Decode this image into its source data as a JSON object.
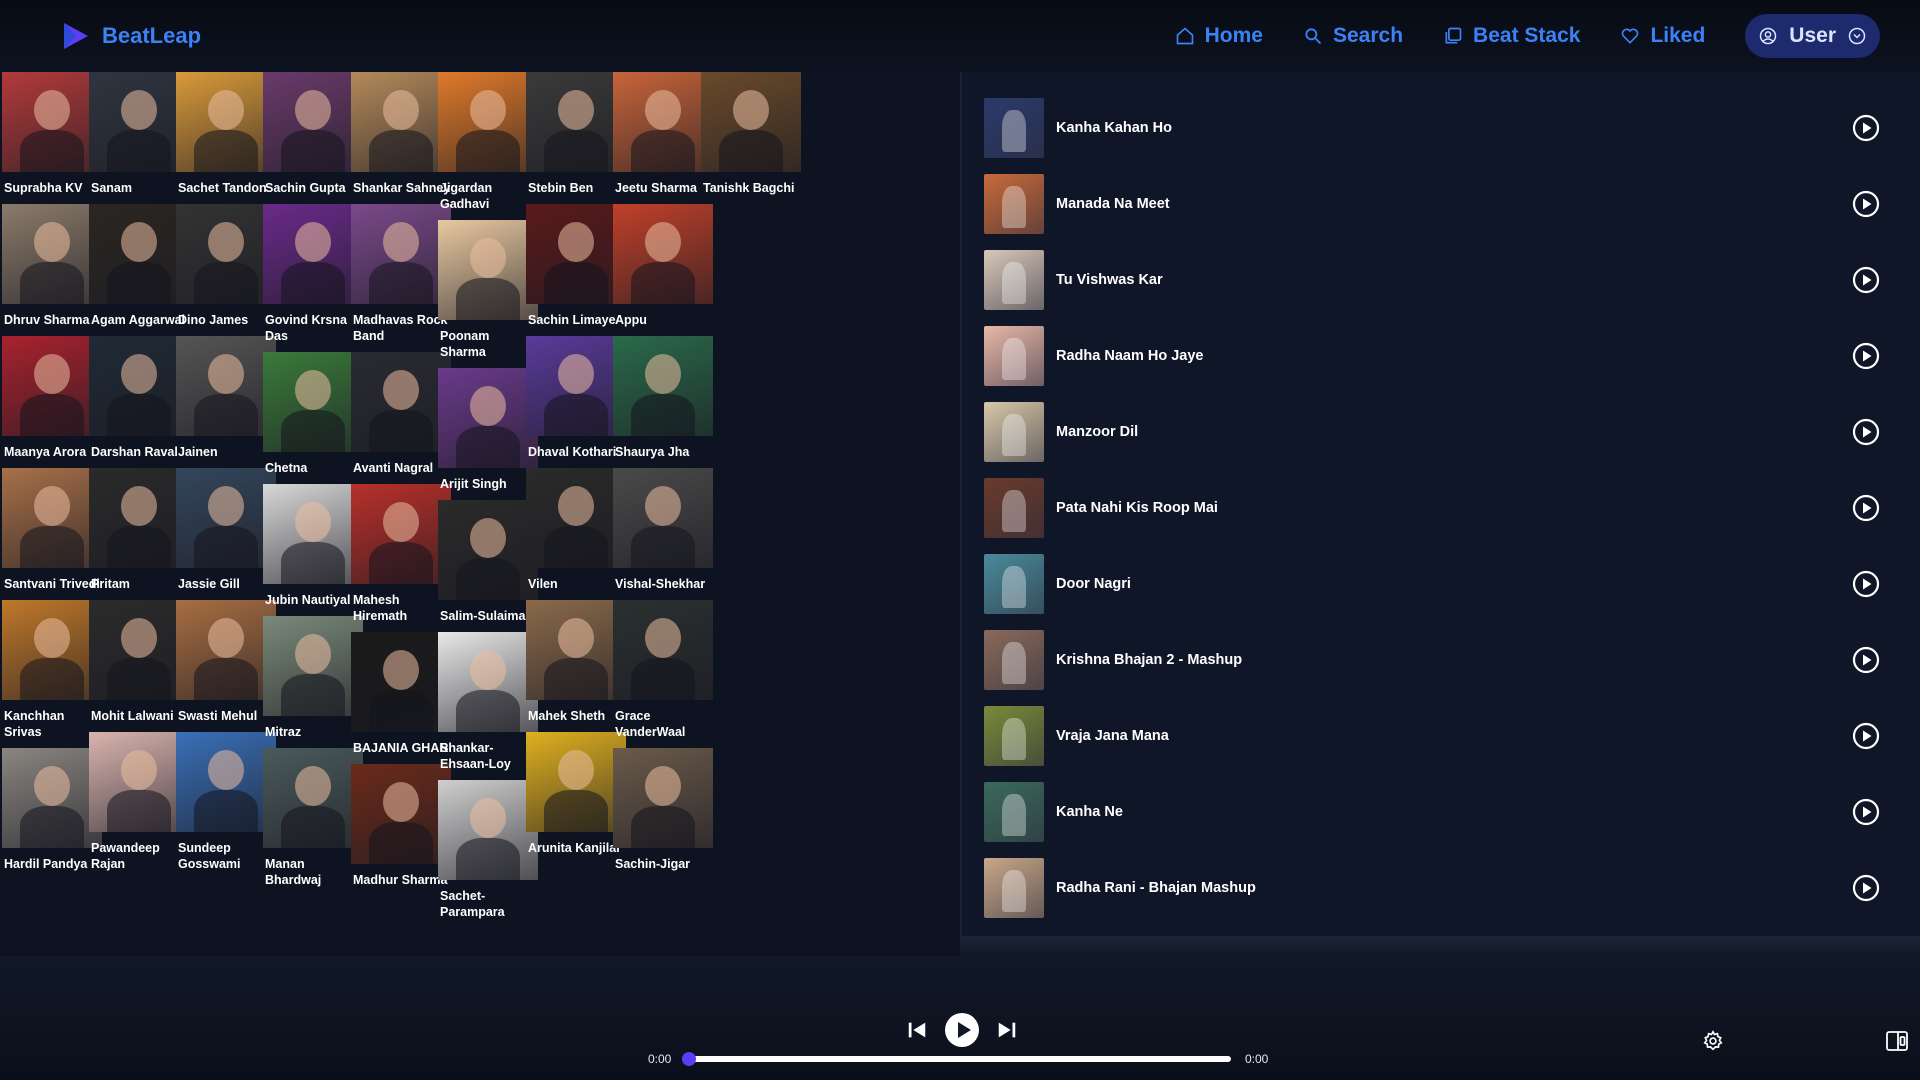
{
  "brand": {
    "name": "BeatLeap",
    "logo_icon": "play-triangle-logo"
  },
  "nav": {
    "home": "Home",
    "search": "Search",
    "beat_stack": "Beat Stack",
    "liked": "Liked",
    "user": "User"
  },
  "artists": {
    "columns": [
      [
        {
          "name": "Suprabha KV",
          "color": "#b23a3a"
        },
        {
          "name": "Dhruv Sharma",
          "color": "#8b7a6a"
        },
        {
          "name": "Maanya Arora",
          "color": "#a8222e"
        },
        {
          "name": "Santvani Trivedi",
          "color": "#a87048"
        },
        {
          "name": "Kanchhan Srivas",
          "color": "#c0782a"
        },
        {
          "name": "Hardil Pandya",
          "color": "#8a8580"
        }
      ],
      [
        {
          "name": "Sanam",
          "color": "#2f3540"
        },
        {
          "name": "Agam Aggarwal",
          "color": "#2a2622"
        },
        {
          "name": "Darshan Raval",
          "color": "#1f2a36"
        },
        {
          "name": "Pritam",
          "color": "#2a2a2a"
        },
        {
          "name": "Mohit Lalwani",
          "color": "#2b2b2b"
        },
        {
          "name": "Pawandeep Rajan",
          "color": "#d9b4ae"
        }
      ],
      [
        {
          "name": "Sachet Tandon",
          "color": "#d99a3a"
        },
        {
          "name": "Dino James",
          "color": "#333333"
        },
        {
          "name": "Jainen",
          "color": "#555555"
        },
        {
          "name": "Jassie Gill",
          "color": "#34465c"
        },
        {
          "name": "Swasti Mehul",
          "color": "#a86e42"
        },
        {
          "name": "Sundeep Gosswami",
          "color": "#3a6fb8"
        }
      ],
      [
        {
          "name": "Sachin Gupta",
          "color": "#6a3a6a"
        },
        {
          "name": "Govind Krsna Das",
          "color": "#6a2a8a"
        },
        {
          "name": "Chetna",
          "color": "#3a7a3a"
        },
        {
          "name": "Jubin Nautiyal",
          "color": "#d8d8d8"
        },
        {
          "name": "Mitraz",
          "color": "#7a8a7a"
        },
        {
          "name": "Manan Bhardwaj",
          "color": "#4a5a5a"
        }
      ],
      [
        {
          "name": "Shankar Sahney",
          "color": "#b48a5a"
        },
        {
          "name": "Madhavas Rock Band",
          "color": "#7a4a8a"
        },
        {
          "name": "Avanti Nagral",
          "color": "#2a2a32"
        },
        {
          "name": "Mahesh Hiremath",
          "color": "#b8302a"
        },
        {
          "name": "BAJANIA GHAR",
          "color": "#1a1a1a"
        },
        {
          "name": "Madhur Sharma",
          "color": "#6a2a1a"
        }
      ],
      [
        {
          "name": "Jigardan Gadhavi",
          "color": "#e07a2a"
        },
        {
          "name": "Poonam Sharma",
          "color": "#e8c8a0"
        },
        {
          "name": "Arijit Singh",
          "color": "#6a3a8a"
        },
        {
          "name": "Salim-Sulaiman",
          "color": "#2a2a2a"
        },
        {
          "name": "Shankar-Ehsaan-Loy",
          "color": "#e8e8e8"
        },
        {
          "name": "Sachet-Parampara",
          "color": "#cfcfcf"
        }
      ],
      [
        {
          "name": "Stebin Ben",
          "color": "#3a3a3a"
        },
        {
          "name": "Sachin Limaye",
          "color": "#5a1a1a"
        },
        {
          "name": "Dhaval Kothari",
          "color": "#5a3a9a"
        },
        {
          "name": "Vilen",
          "color": "#2a2a2a"
        },
        {
          "name": "Mahek Sheth",
          "color": "#8a6a4a"
        },
        {
          "name": "Arunita Kanjilal",
          "color": "#e0b020"
        }
      ],
      [
        {
          "name": "Jeetu Sharma",
          "color": "#c8643a"
        },
        {
          "name": "Appu",
          "color": "#c0402a"
        },
        {
          "name": "Shaurya Jha",
          "color": "#2a6a4a"
        },
        {
          "name": "Vishal-Shekhar",
          "color": "#4a4a4a"
        },
        {
          "name": "Grace VanderWaal",
          "color": "#2a3030"
        },
        {
          "name": "Sachin-Jigar",
          "color": "#6a5a4a"
        }
      ],
      [
        {
          "name": "Tanishk Bagchi",
          "color": "#6a4a2a"
        }
      ]
    ]
  },
  "songs": [
    {
      "title": "Kanha Kahan Ho",
      "color": "#2a3a6a"
    },
    {
      "title": "Manada Na Meet",
      "color": "#c86a3a"
    },
    {
      "title": "Tu Vishwas Kar",
      "color": "#d8c8b8"
    },
    {
      "title": "Radha Naam Ho Jaye",
      "color": "#e8b8a8"
    },
    {
      "title": "Manzoor Dil",
      "color": "#d8c8a8"
    },
    {
      "title": "Pata Nahi Kis Roop Mai",
      "color": "#6a3a2a"
    },
    {
      "title": "Door Nagri",
      "color": "#4a8a9a"
    },
    {
      "title": "Krishna Bhajan 2 - Mashup",
      "color": "#8a6a5a"
    },
    {
      "title": "Vraja Jana Mana",
      "color": "#7a8a3a"
    },
    {
      "title": "Kanha Ne",
      "color": "#3a6a5a"
    },
    {
      "title": "Radha Rani - Bhajan Mashup",
      "color": "#c8a888"
    }
  ],
  "player": {
    "current_time": "0:00",
    "total_time": "0:00",
    "progress": 0
  },
  "colors": {
    "accent": "#3b82f6",
    "background": "#0d1321",
    "knob": "#5b3df5"
  }
}
